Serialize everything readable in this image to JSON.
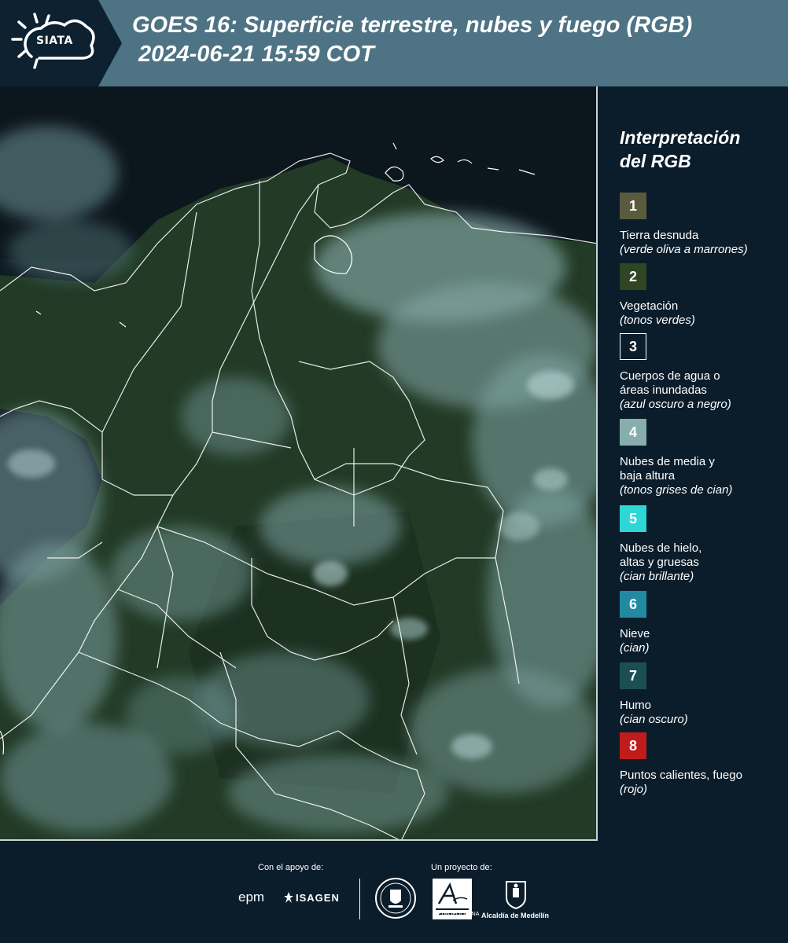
{
  "header": {
    "logo_text": "SIATA",
    "title": "GOES 16: Superficie terrestre, nubes y fuego (RGB)\n 2024-06-21 15:59 COT"
  },
  "legend": {
    "title": "Interpretación\ndel RGB",
    "items": [
      {
        "number": "1",
        "label": "Tierra desnuda",
        "sub": "(verde oliva a marrones)",
        "color": "#5a5a3e"
      },
      {
        "number": "2",
        "label": "Vegetación",
        "sub": "(tonos verdes)",
        "color": "#2f4523"
      },
      {
        "number": "3",
        "label": "Cuerpos de agua o\náreas inundadas",
        "sub": "(azul oscuro a negro)",
        "color": "#0b1d2b"
      },
      {
        "number": "4",
        "label": "Nubes de media y\nbaja altura",
        "sub": "(tonos grises de cian)",
        "color": "#86aeac"
      },
      {
        "number": "5",
        "label": "Nubes de hielo,\naltas y gruesas",
        "sub": "(cian brillante)",
        "color": "#2fd6d6"
      },
      {
        "number": "6",
        "label": "Nieve",
        "sub": "(cian)",
        "color": "#228aa0"
      },
      {
        "number": "7",
        "label": "Humo",
        "sub": "(cian oscuro)",
        "color": "#1c4f52"
      },
      {
        "number": "8",
        "label": "Puntos calientes, fuego",
        "sub": "(rojo)",
        "color": "#c01c1c"
      }
    ]
  },
  "footer": {
    "support_label": "Con el apoyo de:",
    "project_label": "Un proyecto de:",
    "sponsor_1": "epm",
    "sponsor_2": "ISAGEN",
    "area_caption": "METROPOLITANA",
    "medellin_caption": "Alcaldía de Medellín"
  },
  "colors": {
    "header_bg": "#4d7384",
    "page_bg": "#0b1d2b",
    "vegetation": "#2b3f28",
    "cloud": "#8fbcbc",
    "border_lines": "#ffffff"
  }
}
